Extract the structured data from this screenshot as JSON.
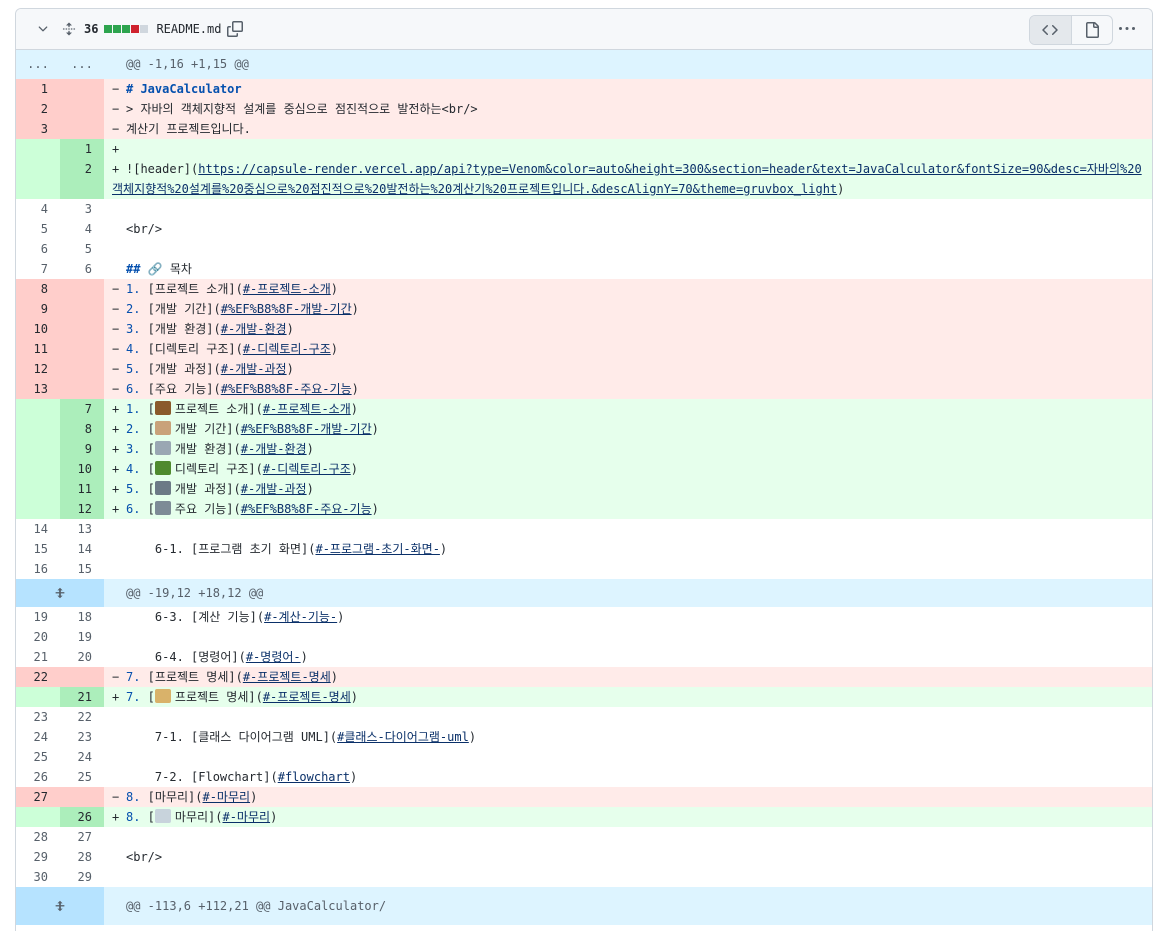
{
  "header": {
    "changes": "36",
    "diffstat": [
      "#2da44e",
      "#2da44e",
      "#2da44e",
      "#cf222e",
      "#d0d7de"
    ],
    "filename": "README.md",
    "icons": [
      "chevron-down-icon",
      "unfold-icon",
      "copy-icon",
      "code-icon",
      "file-icon",
      "kebab-horizontal-icon"
    ]
  },
  "colors": {
    "deletion_bg": "#ffebe9",
    "deletion_gutter": "#ffcecb",
    "addition_bg": "#e6ffec",
    "addition_gutter": "#ccffd8",
    "hunk_bg": "#ddf4ff",
    "link": "#0a3069"
  },
  "hunks": {
    "h1": {
      "old": "...",
      "new": "...",
      "text": "@@ -1,16 +1,15 @@"
    },
    "h2": {
      "text": "@@ -19,12 +18,12 @@"
    },
    "h3": {
      "text": "@@ -113,6 +112,21 @@ JavaCalculator/"
    }
  },
  "lines": {
    "d1": {
      "old": "1",
      "new": "",
      "sign": "−",
      "a": "# JavaCalculator"
    },
    "d2": {
      "old": "2",
      "new": "",
      "sign": "−",
      "a": "> 자바의 객체지향적 설계를 중심으로 점진적으로 발전하는<br/>"
    },
    "d3": {
      "old": "3",
      "new": "",
      "sign": "−",
      "a": "계산기 프로젝트입니다."
    },
    "a1": {
      "old": "",
      "new": "1",
      "sign": "+",
      "a": ""
    },
    "a2": {
      "old": "",
      "new": "2",
      "sign": "+",
      "a": "![header](",
      "link": "https://capsule-render.vercel.app/api?type=Venom&color=auto&height=300&section=header&text=JavaCalculator&fontSize=90&desc=자바의%20객체지향적%20설계를%20중심으로%20점진적으로%20발전하는%20계산기%20프로젝트입니다.&descAlignY=70&theme=gruvbox_light",
      "b": ")"
    },
    "c1": {
      "old": "4",
      "new": "3",
      "a": ""
    },
    "c2": {
      "old": "5",
      "new": "4",
      "a": "<br/>"
    },
    "c3": {
      "old": "6",
      "new": "5",
      "a": ""
    },
    "c4": {
      "old": "7",
      "new": "6",
      "h": "##",
      "a": " 🔗 목차"
    },
    "d8": {
      "old": "8",
      "new": "",
      "sign": "−",
      "n": "1.",
      "a": " [프로젝트 소개](",
      "link": "#-프로젝트-소개",
      "b": ")"
    },
    "d9": {
      "old": "9",
      "new": "",
      "sign": "−",
      "n": "2.",
      "a": " [개발 기간](",
      "link": "#%EF%B8%8F-개발-기간",
      "b": ")"
    },
    "d10": {
      "old": "10",
      "new": "",
      "sign": "−",
      "n": "3.",
      "a": " [개발 환경](",
      "link": "#-개발-환경",
      "b": ")"
    },
    "d11": {
      "old": "11",
      "new": "",
      "sign": "−",
      "n": "4.",
      "a": " [디렉토리 구조](",
      "link": "#-디렉토리-구조",
      "b": ")"
    },
    "d12": {
      "old": "12",
      "new": "",
      "sign": "−",
      "n": "5.",
      "a": " [개발 과정](",
      "link": "#-개발-과정",
      "b": ")"
    },
    "d13": {
      "old": "13",
      "new": "",
      "sign": "−",
      "n": "6.",
      "a": " [주요 기능](",
      "link": "#%EF%B8%8F-주요-기능",
      "b": ")"
    },
    "a7": {
      "old": "",
      "new": "7",
      "sign": "+",
      "n": "1.",
      "pre": " [",
      "emoji": "#8a5a2b",
      "a": "프로젝트 소개](",
      "link": "#-프로젝트-소개",
      "b": ")"
    },
    "a8": {
      "old": "",
      "new": "8",
      "sign": "+",
      "n": "2.",
      "pre": " [",
      "emoji": "#c9a27a",
      "a": "개발 기간](",
      "link": "#%EF%B8%8F-개발-기간",
      "b": ")"
    },
    "a9": {
      "old": "",
      "new": "9",
      "sign": "+",
      "n": "3.",
      "pre": " [",
      "emoji": "#9aa7b3",
      "a": "개발 환경](",
      "link": "#-개발-환경",
      "b": ")"
    },
    "a10": {
      "old": "",
      "new": "10",
      "sign": "+",
      "n": "4.",
      "pre": " [",
      "emoji": "#4f8a2e",
      "a": "디렉토리 구조](",
      "link": "#-디렉토리-구조",
      "b": ")"
    },
    "a11": {
      "old": "",
      "new": "11",
      "sign": "+",
      "n": "5.",
      "pre": " [",
      "emoji": "#6c7a86",
      "a": "개발 과정](",
      "link": "#-개발-과정",
      "b": ")"
    },
    "a12": {
      "old": "",
      "new": "12",
      "sign": "+",
      "n": "6.",
      "pre": " [",
      "emoji": "#7d8b96",
      "a": "주요 기능](",
      "link": "#%EF%B8%8F-주요-기능",
      "b": ")"
    },
    "c14": {
      "old": "14",
      "new": "13",
      "a": ""
    },
    "c15": {
      "old": "15",
      "new": "14",
      "a": "    6-1. [프로그램 초기 화면](",
      "link": "#-프로그램-초기-화면-",
      "b": ")"
    },
    "c16": {
      "old": "16",
      "new": "15",
      "a": ""
    },
    "c19": {
      "old": "19",
      "new": "18",
      "a": "    6-3. [계산 기능](",
      "link": "#-계산-기능-",
      "b": ")"
    },
    "c20": {
      "old": "20",
      "new": "19",
      "a": ""
    },
    "c21": {
      "old": "21",
      "new": "20",
      "a": "    6-4. [명령어](",
      "link": "#-명령어-",
      "b": ")"
    },
    "d22": {
      "old": "22",
      "new": "",
      "sign": "−",
      "n": "7.",
      "a": " [프로젝트 명세](",
      "link": "#-프로젝트-명세",
      "b": ")"
    },
    "a21": {
      "old": "",
      "new": "21",
      "sign": "+",
      "n": "7.",
      "pre": " [",
      "emoji": "#d9b26a",
      "a": "프로젝트 명세](",
      "link": "#-프로젝트-명세",
      "b": ")"
    },
    "c23": {
      "old": "23",
      "new": "22",
      "a": ""
    },
    "c24": {
      "old": "24",
      "new": "23",
      "a": "    7-1. [클래스 다이어그램 UML](",
      "link": "#클래스-다이어그램-uml",
      "b": ")"
    },
    "c25": {
      "old": "25",
      "new": "24",
      "a": ""
    },
    "c26": {
      "old": "26",
      "new": "25",
      "a": "    7-2. [Flowchart](",
      "link": "#flowchart",
      "b": ")"
    },
    "d27": {
      "old": "27",
      "new": "",
      "sign": "−",
      "n": "8.",
      "a": " [마무리](",
      "link": "#-마무리",
      "b": ")"
    },
    "a26": {
      "old": "",
      "new": "26",
      "sign": "+",
      "n": "8.",
      "pre": " [",
      "emoji": "#c8d3dc",
      "a": "마무리](",
      "link": "#-마무리",
      "b": ")"
    },
    "c28": {
      "old": "28",
      "new": "27",
      "a": ""
    },
    "c29": {
      "old": "29",
      "new": "28",
      "a": "<br/>"
    },
    "c30": {
      "old": "30",
      "new": "29",
      "a": ""
    }
  }
}
